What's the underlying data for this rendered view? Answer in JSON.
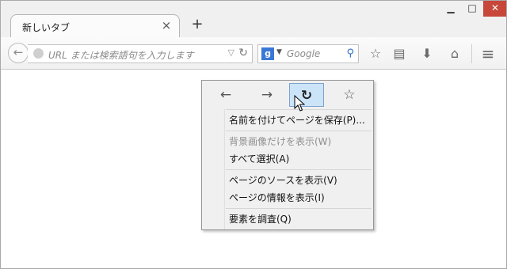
{
  "window": {
    "min_glyph": "▁",
    "max_glyph": "□",
    "close_glyph": "✕"
  },
  "tab": {
    "title": "新しいタブ",
    "close_glyph": "×",
    "new_tab_glyph": "+"
  },
  "navbar": {
    "back_glyph": "←",
    "url_placeholder": "URL または検索語句を入力します",
    "url_drop_glyph": "▽",
    "reload_glyph": "↻",
    "search_engine_letter": "g",
    "search_drop_glyph": "▼",
    "search_placeholder": "Google",
    "search_glyph": "⚲",
    "icons": {
      "bookmark": "☆",
      "reading_list": "▤",
      "download": "⬇",
      "home": "⌂",
      "menu": "≡"
    }
  },
  "context_menu": {
    "icons": {
      "back": "←",
      "forward": "→",
      "reload": "↻",
      "bookmark": "☆"
    },
    "items": [
      {
        "label": "名前を付けてページを保存(P)...",
        "disabled": false
      },
      {
        "label": "背景画像だけを表示(W)",
        "disabled": true
      },
      {
        "label": "すべて選択(A)",
        "disabled": false
      },
      {
        "label": "ページのソースを表示(V)",
        "disabled": false
      },
      {
        "label": "ページの情報を表示(I)",
        "disabled": false
      },
      {
        "label": "要素を調査(Q)",
        "disabled": false
      }
    ]
  },
  "colors": {
    "hover_highlight": "#cce4f7",
    "close_button": "#c7473a",
    "search_logo": "#3a78d6"
  }
}
